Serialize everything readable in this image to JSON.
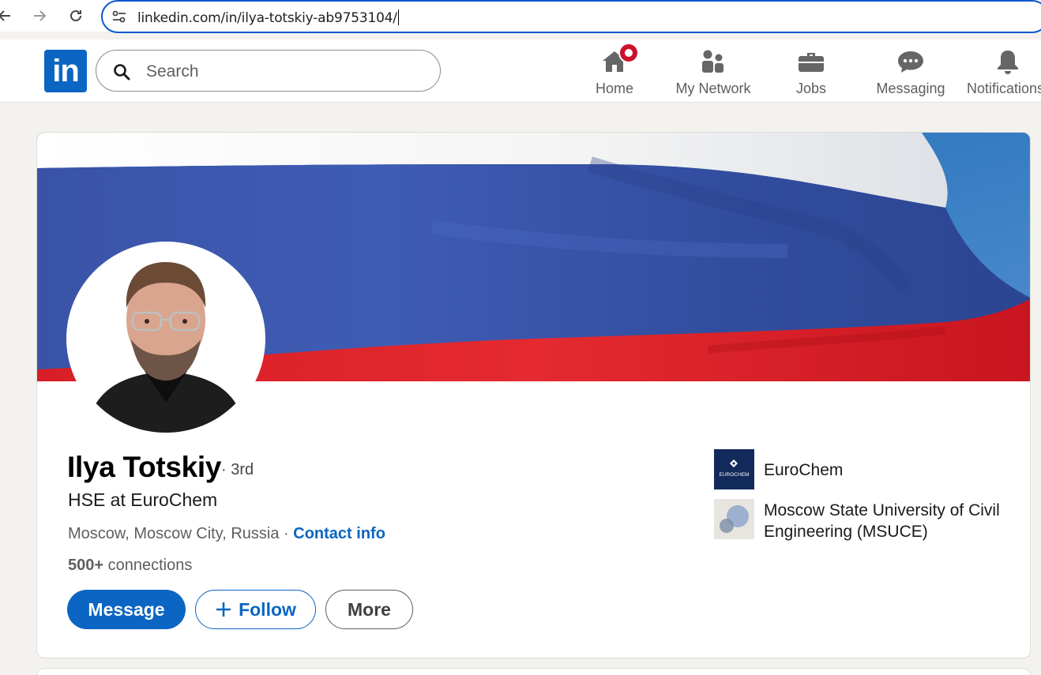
{
  "browser": {
    "url": "linkedin.com/in/ilya-totskiy-ab9753104/"
  },
  "nav": {
    "logo_text": "in",
    "search_placeholder": "Search",
    "items": [
      {
        "label": "Home",
        "icon": "home-icon"
      },
      {
        "label": "My Network",
        "icon": "network-icon"
      },
      {
        "label": "Jobs",
        "icon": "briefcase-icon"
      },
      {
        "label": "Messaging",
        "icon": "messaging-icon"
      },
      {
        "label": "Notifications",
        "icon": "bell-icon"
      }
    ]
  },
  "profile": {
    "name": "Ilya Totskiy",
    "degree": "· 3rd",
    "headline": "HSE at EuroChem",
    "location": "Moscow, Moscow City, Russia",
    "location_separator": " · ",
    "contact_label": "Contact info",
    "connections_count": "500+",
    "connections_label": " connections",
    "buttons": {
      "message": "Message",
      "follow": "Follow",
      "more": "More"
    },
    "experience": [
      {
        "name": "EuroChem",
        "logo_text": "EUROCHEM"
      },
      {
        "name": "Moscow State University of Civil Engineering (MSUCE)"
      }
    ]
  },
  "colors": {
    "brand": "#0a66c2",
    "badge": "#cb112d",
    "flag_white": "#f2f2f2",
    "flag_blue": "#3b55ad",
    "flag_red": "#e0202a"
  }
}
